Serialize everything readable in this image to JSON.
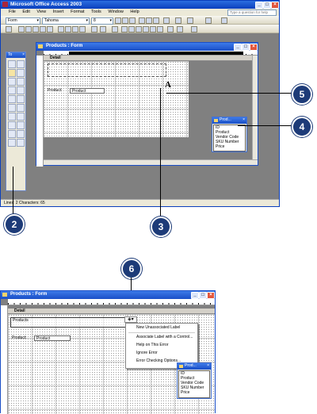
{
  "top_window": {
    "title": "Microsoft Office Access 2003",
    "menus": [
      "File",
      "Edit",
      "View",
      "Insert",
      "Format",
      "Tools",
      "Window",
      "Help"
    ],
    "help_placeholder": "Type a question for help",
    "object_combo": "Form",
    "font_combo": "Tahoma",
    "size_combo": "8"
  },
  "form_window_1": {
    "title": "Products : Form",
    "section": "Detail",
    "field_label": "Product:",
    "field_value": "Product",
    "new_label_caret": "A"
  },
  "toolbox": {
    "title": "To"
  },
  "field_list_1": {
    "title": "Prod...",
    "items": [
      "ID",
      "Product",
      "Vendor Code",
      "SKU Number",
      "Price"
    ]
  },
  "status_bar": {
    "text": "Lines: 2 Characters: 65"
  },
  "callouts": [
    "2",
    "3",
    "4",
    "5",
    "6"
  ],
  "form_window_2": {
    "title": "Products : Form",
    "section": "Detail",
    "label_text": "Products",
    "field_label": "Product:",
    "field_value": "Product"
  },
  "context_menu": {
    "items": [
      "New Unassociated Label",
      "Associate Label with a Control...",
      "Help on This Error",
      "Ignore Error",
      "Error Checking Options..."
    ]
  },
  "field_list_2": {
    "title": "Prod...",
    "items": [
      "ID",
      "Product",
      "Vendor Code",
      "SKU Number",
      "Price"
    ]
  }
}
